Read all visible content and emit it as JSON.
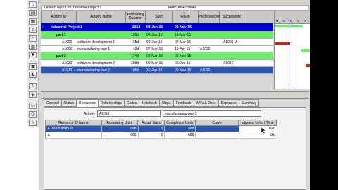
{
  "window": {
    "layout_label": "Layout: layout for Industrial Project 1",
    "filter_label": "Filter: All Activities"
  },
  "gantt": {
    "columns": [
      "Activity ID",
      "Activity Name",
      "Remaining Duration",
      "Start",
      "Finish",
      "Predecessors",
      "Successors"
    ],
    "rows": [
      {
        "type": "project",
        "name": "Industrial Project 1",
        "dur": "221d",
        "start": "02-Jan-15",
        "finish": "06-Nov-15"
      },
      {
        "type": "wbs",
        "name": "part 1",
        "dur": "108d",
        "start": "02-Jan-15",
        "finish": "19-Mar-15"
      },
      {
        "type": "act",
        "id": "A1020",
        "name": "software development 1",
        "dur": "65d",
        "start": "02-Jan-15",
        "finish": "07-Mar-15",
        "succ": "A1000, A"
      },
      {
        "type": "act",
        "id": "A1000",
        "name": "manufacturing part 1",
        "dur": "43d",
        "start": "07-Mar-15",
        "finish": "19-Apr-15",
        "pred": "A1020"
      },
      {
        "type": "wbs",
        "name": "part 2",
        "dur": "174d",
        "start": "09-Mar-15",
        "finish": "06-Nov-15"
      },
      {
        "type": "act",
        "id": "A1030",
        "name": "software development 2",
        "dur": "108d",
        "start": "09-Mar-15",
        "finish": "09-Jun-15",
        "succ": "A1010"
      },
      {
        "type": "sel",
        "id": "A1010",
        "name": "manufacturing part 2",
        "dur": "86d",
        "start": "10-Jun-15",
        "finish": "06-Nov-15",
        "pred": "A1030"
      }
    ],
    "timeline_months": [
      "M",
      "A",
      "M",
      "J",
      "J"
    ]
  },
  "tabs": [
    "General",
    "Status",
    "Resources",
    "Relationships",
    "Codes",
    "Notebook",
    "Steps",
    "Feedback",
    "WPs & Docs",
    "Expenses",
    "Summary"
  ],
  "active_tab": "Resources",
  "details": {
    "activity_label": "Activity",
    "activity_id": "A1010",
    "activity_name": "manufacturing part 2"
  },
  "resource_table": {
    "columns": [
      "Resource ID Name",
      "Remaining Units",
      "Actual Units",
      "Completion Units",
      "Curve",
      "udgeted Units / Time"
    ],
    "rows": [
      {
        "name": "R005 Andy R",
        "remaining": "688",
        "actual": "0",
        "completion": "688",
        "curve": "",
        "budget": "10/d"
      },
      {
        "name": "",
        "remaining": "688",
        "actual": "0",
        "completion": "688",
        "curve": "",
        "budget": "8/d"
      }
    ]
  }
}
